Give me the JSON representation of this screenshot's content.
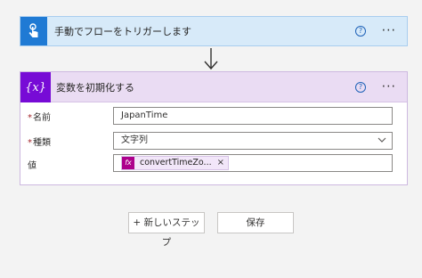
{
  "trigger": {
    "title": "手動でフローをトリガーします",
    "icon": "hand-touch-icon",
    "help_icon": "?",
    "more_icon": "···",
    "accent_color": "#1f7ad4"
  },
  "variable_step": {
    "title": "変数を初期化する",
    "icon": "variable-icon",
    "icon_text": "{x}",
    "help_icon": "?",
    "more_icon": "···",
    "accent_color": "#770bd6",
    "fields": {
      "name": {
        "required_mark": "*",
        "label": "名前",
        "value": "JapanTime"
      },
      "type": {
        "required_mark": "*",
        "label": "種類",
        "value": "文字列"
      },
      "value": {
        "label": "値",
        "token": {
          "fx": "fx",
          "label": "convertTimeZo...",
          "remove": "×"
        }
      }
    }
  },
  "actions": {
    "new_step_label": "+ 新しいステップ",
    "save_label": "保存"
  }
}
